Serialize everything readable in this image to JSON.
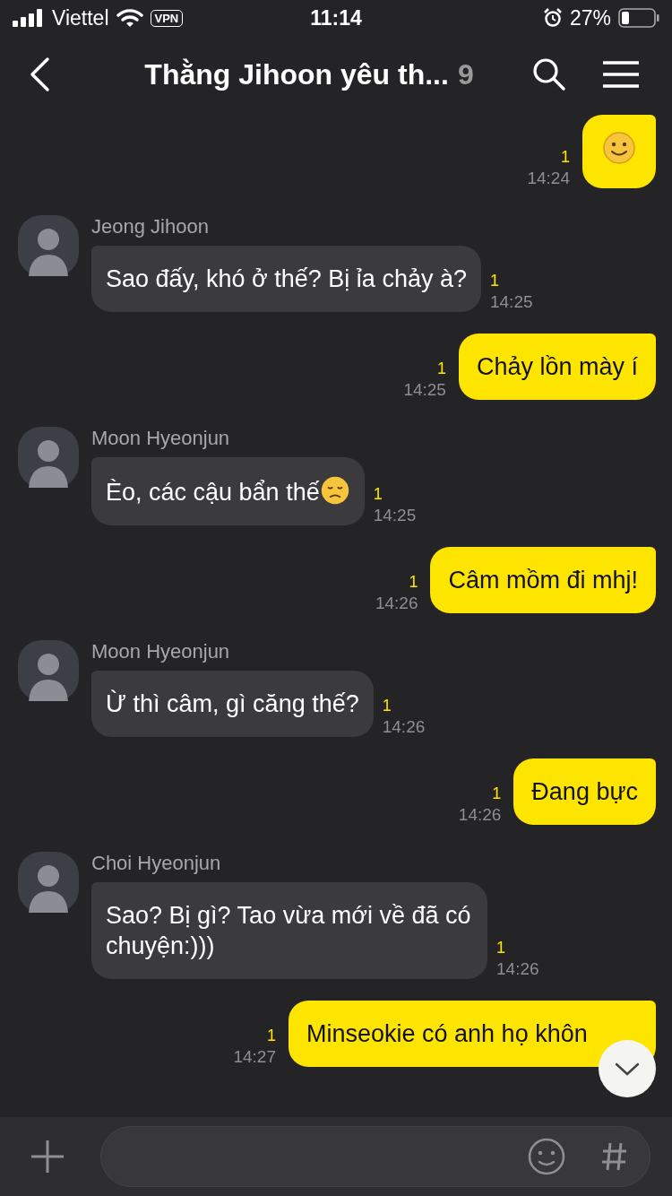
{
  "status_bar": {
    "carrier": "Viettel",
    "vpn": "VPN",
    "time": "11:14",
    "battery": "27%"
  },
  "header": {
    "title": "Thằng Jihoon yêu th...",
    "member_count": "9"
  },
  "messages": [
    {
      "kind": "out",
      "emoticon": {
        "kind": "smile"
      },
      "unread": "1",
      "time": "14:24"
    },
    {
      "kind": "in",
      "sender": "Jeong Jihoon",
      "text": "Sao đấy, khó ở thế? Bị ỉa chảy à?",
      "unread": "1",
      "time": "14:25"
    },
    {
      "kind": "out",
      "text": "Chảy lồn mày í",
      "unread": "1",
      "time": "14:25"
    },
    {
      "kind": "in",
      "sender": "Moon Hyeonjun",
      "text": "Èo, các cậu bẩn thế",
      "emoticon": {
        "kind": "sad"
      },
      "unread": "1",
      "time": "14:25"
    },
    {
      "kind": "out",
      "text": "Câm mồm đi mhj!",
      "unread": "1",
      "time": "14:26"
    },
    {
      "kind": "in",
      "sender": "Moon Hyeonjun",
      "text": "Ừ thì câm, gì căng thế?",
      "unread": "1",
      "time": "14:26"
    },
    {
      "kind": "out",
      "text": "Đang bực",
      "unread": "1",
      "time": "14:26"
    },
    {
      "kind": "in",
      "sender": "Choi Hyeonjun",
      "text": "Sao? Bị gì? Tao vừa mới về đã có chuyện:)))",
      "unread": "1",
      "time": "14:26"
    },
    {
      "kind": "out",
      "text": "Minseokie có anh họ khôn",
      "unread": "1",
      "time": "14:27"
    }
  ]
}
